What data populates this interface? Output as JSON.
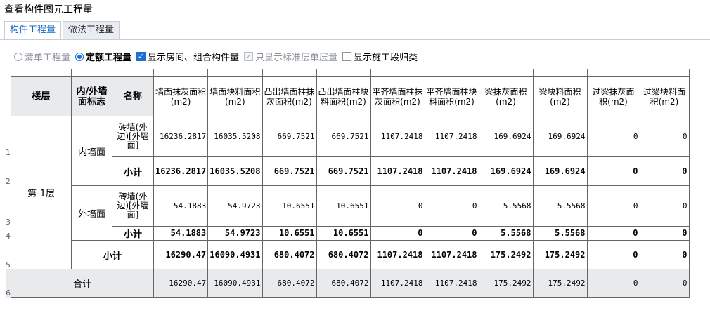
{
  "window": {
    "title": "查看构件图元工程量"
  },
  "tabs": [
    {
      "label": "构件工程量",
      "active": true
    },
    {
      "label": "做法工程量",
      "active": false
    }
  ],
  "options": {
    "radio_list": {
      "label": "清单工程量",
      "selected": false
    },
    "radio_quota": {
      "label": "定额工程量",
      "selected": true
    },
    "cb_rooms": {
      "label": "显示房间、组合构件量",
      "checked": true
    },
    "cb_std": {
      "label": "只显示标准层单层量",
      "checked": true,
      "disabled": true
    },
    "cb_section": {
      "label": "显示施工段归类",
      "checked": false
    }
  },
  "table": {
    "headers": {
      "floor": "楼层",
      "side": "内/外墙面标志",
      "name": "名称",
      "cols": [
        "墙面抹灰面积(m2)",
        "墙面块料面积(m2)",
        "凸出墙面柱抹灰面积(m2)",
        "凸出墙面柱块料面积(m2)",
        "平齐墙面柱抹灰面积(m2)",
        "平齐墙面柱块料面积(m2)",
        "梁抹灰面积(m2)",
        "梁块料面积(m2)",
        "过梁抹灰面积(m2)",
        "过梁块料面积(m2)"
      ]
    },
    "floor_label": "第-1层",
    "inner_label": "内墙面",
    "outer_label": "外墙面",
    "rows": [
      {
        "num": "1",
        "name": "砖墙(外边)[外墙面]",
        "values": [
          "16236.2817",
          "16035.5208",
          "669.7521",
          "669.7521",
          "1107.2418",
          "1107.2418",
          "169.6924",
          "169.6924",
          "0",
          "0"
        ]
      },
      {
        "num": "2",
        "name": "小计",
        "values": [
          "16236.2817",
          "16035.5208",
          "669.7521",
          "669.7521",
          "1107.2418",
          "1107.2418",
          "169.6924",
          "169.6924",
          "0",
          "0"
        ]
      },
      {
        "num": "3",
        "name": "砖墙(外边)[外墙面]",
        "values": [
          "54.1883",
          "54.9723",
          "10.6551",
          "10.6551",
          "0",
          "0",
          "5.5568",
          "5.5568",
          "0",
          "0"
        ]
      },
      {
        "num": "4",
        "name": "小计",
        "values": [
          "54.1883",
          "54.9723",
          "10.6551",
          "10.6551",
          "0",
          "0",
          "5.5568",
          "5.5568",
          "0",
          "0"
        ]
      },
      {
        "num": "5",
        "name": "小计",
        "values": [
          "16290.47",
          "16090.4931",
          "680.4072",
          "680.4072",
          "1107.2418",
          "1107.2418",
          "175.2492",
          "175.2492",
          "0",
          "0"
        ]
      },
      {
        "num": "6",
        "name": "合计",
        "values": [
          "16290.47",
          "16090.4931",
          "680.4072",
          "680.4072",
          "1107.2418",
          "1107.2418",
          "175.2492",
          "175.2492",
          "0",
          "0"
        ]
      }
    ]
  }
}
